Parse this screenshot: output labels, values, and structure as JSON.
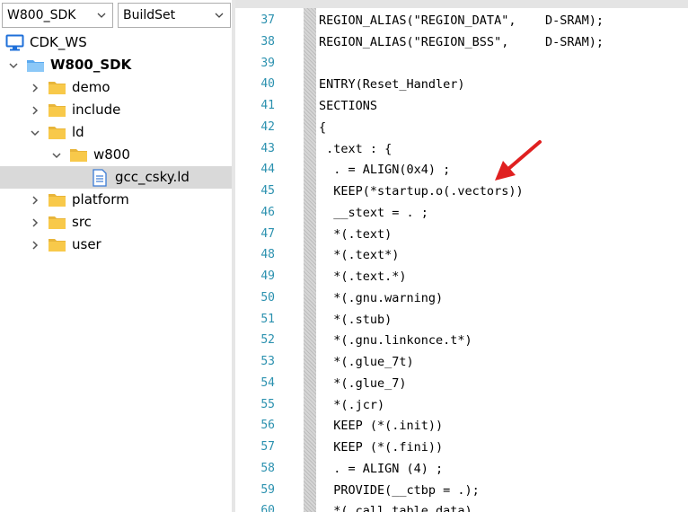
{
  "toolbar": {
    "project_select": "W800_SDK",
    "config_select": "BuildSet"
  },
  "tree": {
    "workspace": "CDK_WS",
    "project": "W800_SDK",
    "folders": {
      "demo": "demo",
      "include": "include",
      "ld": "ld",
      "w800": "w800",
      "platform": "platform",
      "src": "src",
      "user": "user"
    },
    "file": "gcc_csky.ld"
  },
  "editor": {
    "lines": [
      {
        "num": "37",
        "text": "REGION_ALIAS(\"REGION_DATA\",    D-SRAM);"
      },
      {
        "num": "38",
        "text": "REGION_ALIAS(\"REGION_BSS\",     D-SRAM);"
      },
      {
        "num": "39",
        "text": ""
      },
      {
        "num": "40",
        "text": "ENTRY(Reset_Handler)"
      },
      {
        "num": "41",
        "text": "SECTIONS"
      },
      {
        "num": "42",
        "text": "{"
      },
      {
        "num": "43",
        "text": " .text : {"
      },
      {
        "num": "44",
        "text": "  . = ALIGN(0x4) ;"
      },
      {
        "num": "45",
        "text": "  KEEP(*startup.o(.vectors))"
      },
      {
        "num": "46",
        "text": "  __stext = . ;"
      },
      {
        "num": "47",
        "text": "  *(.text)"
      },
      {
        "num": "48",
        "text": "  *(.text*)"
      },
      {
        "num": "49",
        "text": "  *(.text.*)"
      },
      {
        "num": "50",
        "text": "  *(.gnu.warning)"
      },
      {
        "num": "51",
        "text": "  *(.stub)"
      },
      {
        "num": "52",
        "text": "  *(.gnu.linkonce.t*)"
      },
      {
        "num": "53",
        "text": "  *(.glue_7t)"
      },
      {
        "num": "54",
        "text": "  *(.glue_7)"
      },
      {
        "num": "55",
        "text": "  *(.jcr)"
      },
      {
        "num": "56",
        "text": "  KEEP (*(.init))"
      },
      {
        "num": "57",
        "text": "  KEEP (*(.fini))"
      },
      {
        "num": "58",
        "text": "  . = ALIGN (4) ;"
      },
      {
        "num": "59",
        "text": "  PROVIDE(__ctbp = .);"
      },
      {
        "num": "60",
        "text": "  *(.call_table_data)"
      }
    ]
  },
  "colors": {
    "line_number": "#2b91af",
    "selection": "#d9d9d9",
    "folder": "#f8c94a",
    "annotation_arrow": "#e02020"
  }
}
